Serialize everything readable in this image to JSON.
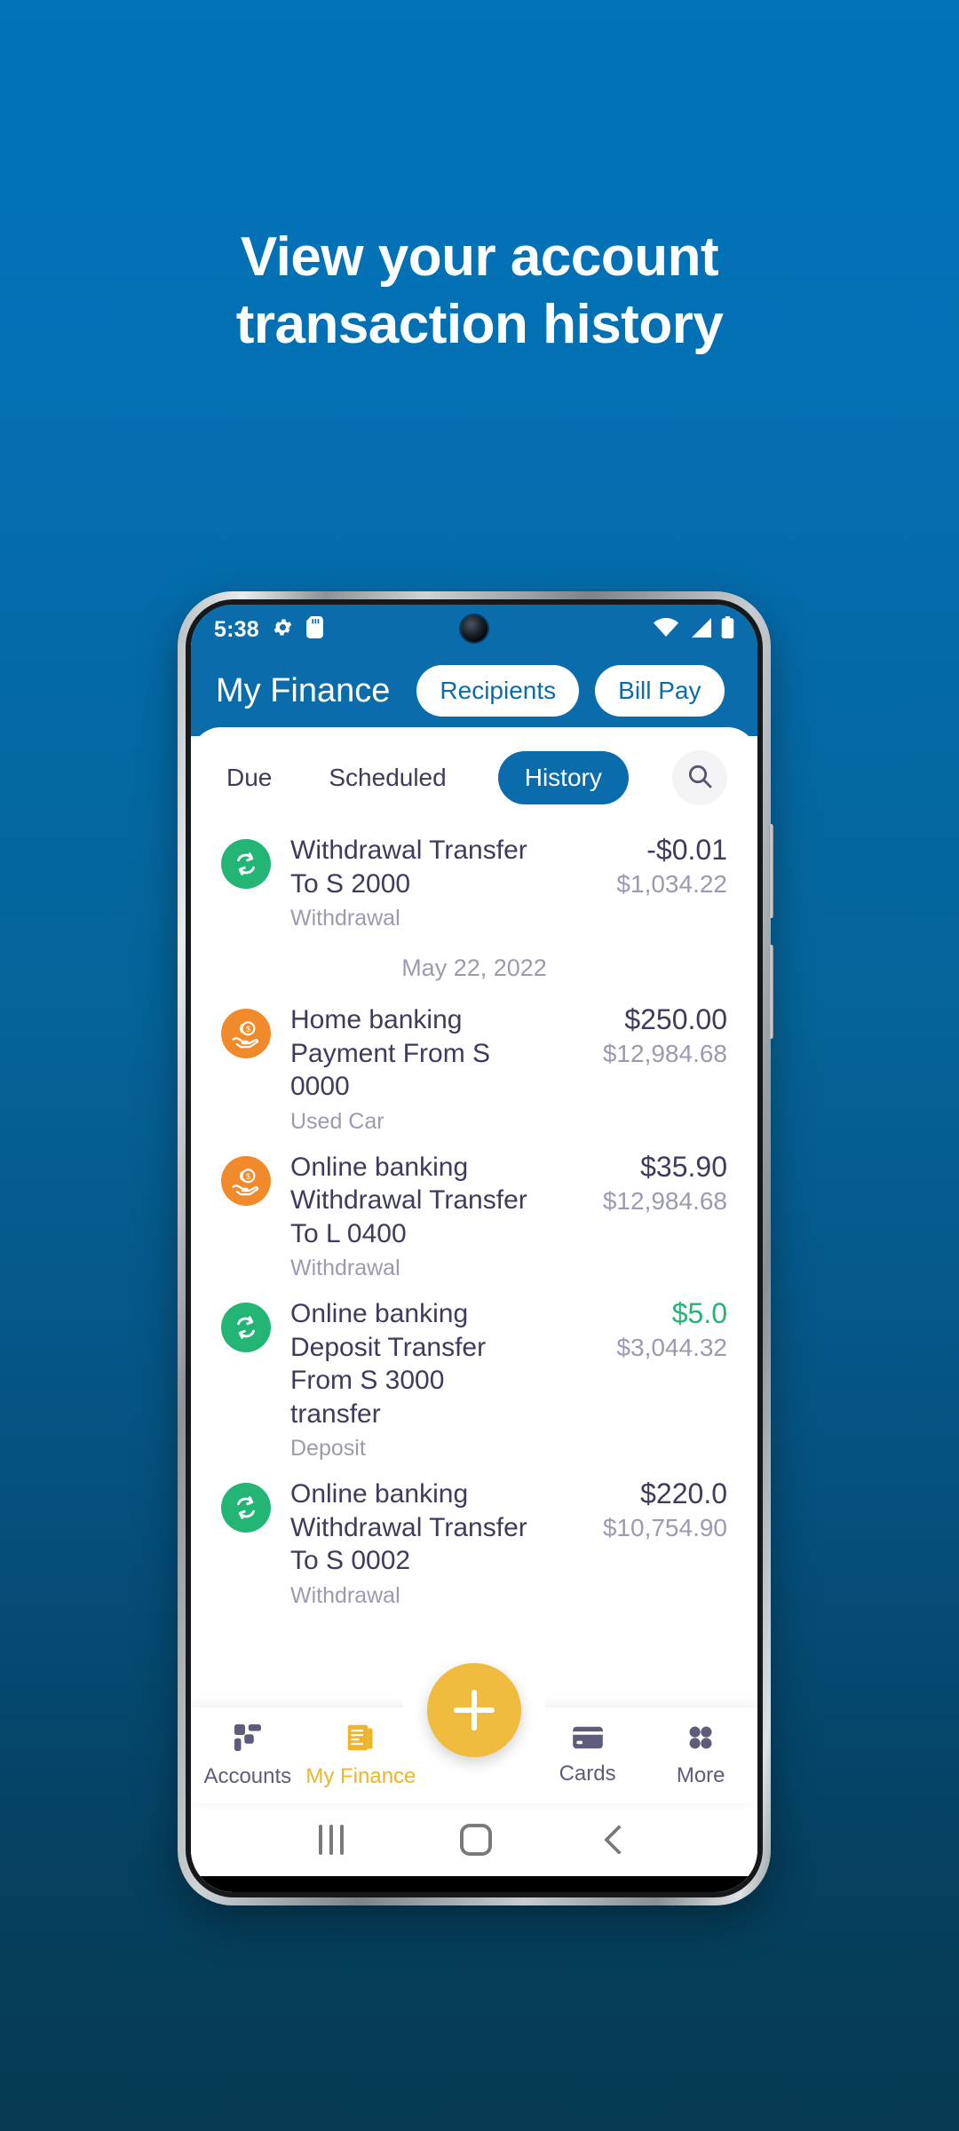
{
  "promo": {
    "headline_line1": "View your account",
    "headline_line2": "transaction history",
    "background_top": "#0073b9",
    "background_bottom": "#063a52"
  },
  "status_bar": {
    "time": "5:38",
    "icons": [
      "gear-icon",
      "sd-card-icon",
      "wifi-icon",
      "signal-icon",
      "battery-icon"
    ]
  },
  "app_header": {
    "title": "My Finance",
    "buttons": [
      {
        "label": "Recipients"
      },
      {
        "label": "Bill Pay"
      }
    ]
  },
  "tabs": {
    "items": [
      {
        "label": "Due",
        "active": false
      },
      {
        "label": "Scheduled",
        "active": false
      },
      {
        "label": "History",
        "active": true
      }
    ],
    "search_icon": "search-icon",
    "active_color": "#0a6cab"
  },
  "transactions": [
    {
      "icon": "sync-arrows-icon",
      "icon_color": "#22b573",
      "title": "Withdrawal Transfer To S 2000",
      "subtitle": "Withdrawal",
      "amount": "-$0.01",
      "amount_positive": false,
      "balance": "$1,034.22"
    },
    {
      "icon": "hand-coin-icon",
      "icon_color": "#f08a2a",
      "title": "Home banking Payment From S 0000",
      "subtitle": "Used Car",
      "amount": "$250.00",
      "amount_positive": false,
      "balance": "$12,984.68"
    },
    {
      "icon": "hand-coin-icon",
      "icon_color": "#f08a2a",
      "title": "Online banking Withdrawal Transfer To L 0400",
      "subtitle": "Withdrawal",
      "amount": "$35.90",
      "amount_positive": false,
      "balance": "$12,984.68"
    },
    {
      "icon": "sync-arrows-icon",
      "icon_color": "#22b573",
      "title": "Online banking Deposit Transfer From S 3000 transfer",
      "subtitle": "Deposit",
      "amount": "$5.0",
      "amount_positive": true,
      "balance": "$3,044.32"
    },
    {
      "icon": "sync-arrows-icon",
      "icon_color": "#22b573",
      "title": "Online banking Withdrawal Transfer To S 0002",
      "subtitle": "Withdrawal",
      "amount": "$220.0",
      "amount_positive": false,
      "balance": "$10,754.90"
    }
  ],
  "date_separator": "May 22, 2022",
  "bottom_nav": {
    "items": [
      {
        "label": "Accounts",
        "icon": "grid-blocks-icon",
        "active": false
      },
      {
        "label": "My Finance",
        "icon": "receipt-icon",
        "active": true
      },
      {
        "label": "Cards",
        "icon": "credit-card-icon",
        "active": false
      },
      {
        "label": "More",
        "icon": "four-dots-icon",
        "active": false
      }
    ],
    "fab_icon": "plus-icon",
    "fab_color": "#f0bc3f",
    "active_color": "#f0b429"
  },
  "android_nav": {
    "recents": "recents-icon",
    "home": "home-icon",
    "back": "back-icon"
  }
}
